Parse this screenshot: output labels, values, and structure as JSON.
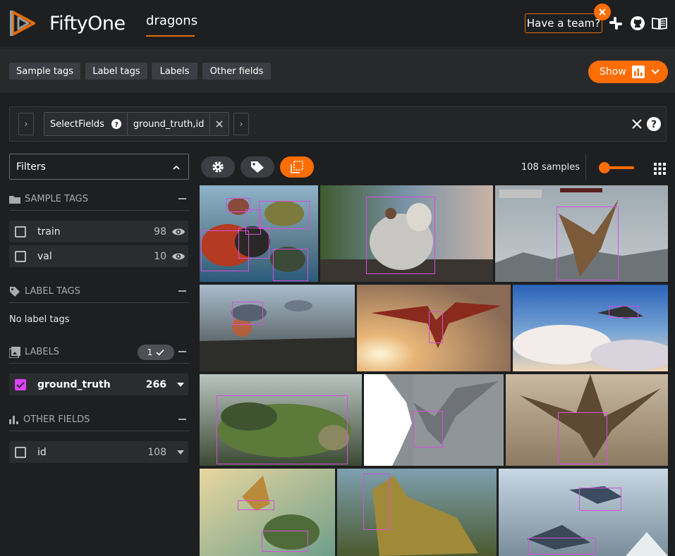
{
  "header": {
    "brand": "FiftyOne",
    "dataset": "dragons",
    "team_button": "Have a team?"
  },
  "toolbar": {
    "buttons": [
      "Sample tags",
      "Label tags",
      "Labels",
      "Other fields"
    ],
    "show_label": "Show"
  },
  "view_bar": {
    "stage_name": "SelectFields",
    "stage_value": "ground_truth,id"
  },
  "sidebar": {
    "filters_label": "Filters",
    "sample_tags": {
      "title": "SAMPLE TAGS",
      "items": [
        {
          "label": "train",
          "count": "98"
        },
        {
          "label": "val",
          "count": "10"
        }
      ]
    },
    "label_tags": {
      "title": "LABEL TAGS",
      "empty": "No label tags"
    },
    "labels": {
      "title": "LABELS",
      "badge": "1",
      "items": [
        {
          "label": "ground_truth",
          "count": "266"
        }
      ]
    },
    "other_fields": {
      "title": "OTHER FIELDS",
      "items": [
        {
          "label": "id",
          "count": "108"
        }
      ]
    }
  },
  "grid": {
    "sample_count": "108 samples",
    "accent": "#ff6d04",
    "bbox_color": "#d64fdc"
  }
}
